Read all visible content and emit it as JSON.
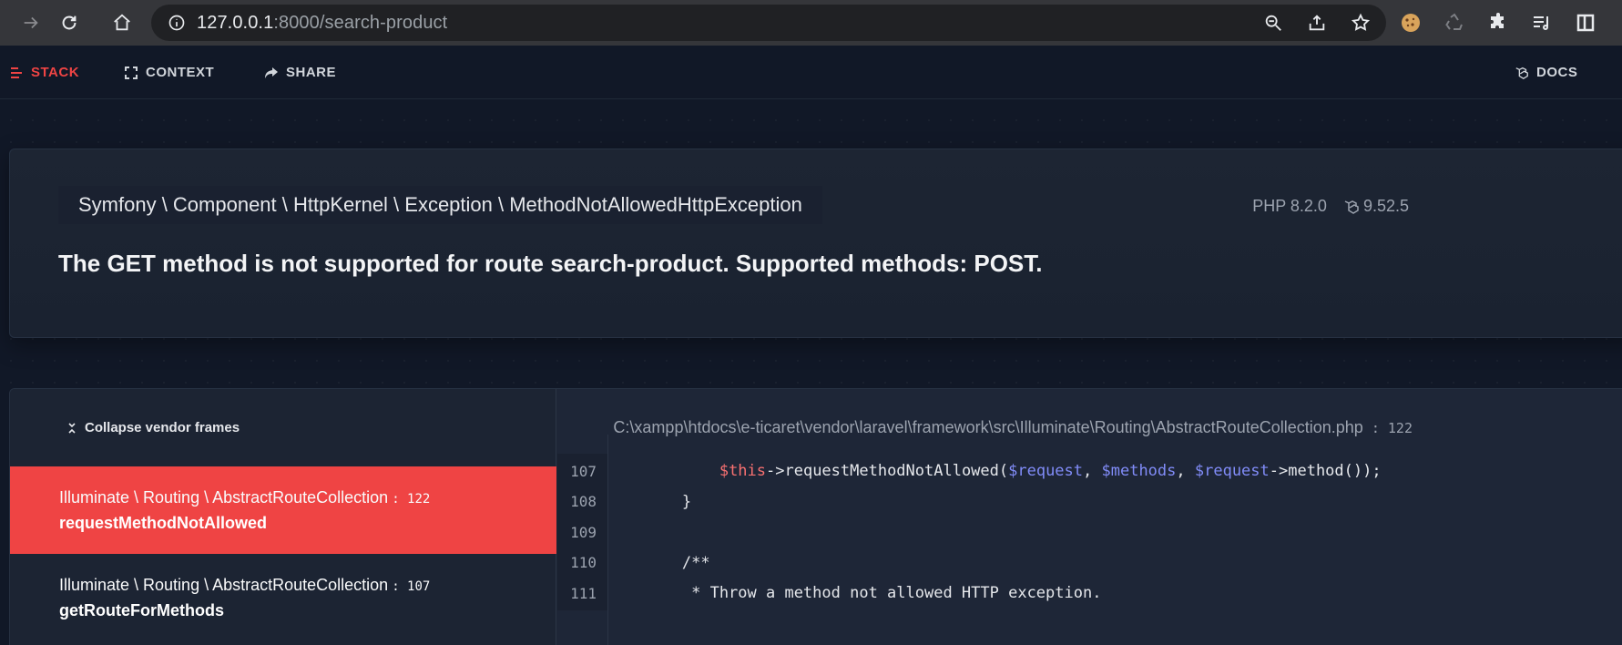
{
  "browser": {
    "url_host": "127.0.0.1",
    "url_path": ":8000/search-product"
  },
  "nav": {
    "stack": "STACK",
    "context": "CONTEXT",
    "share": "SHARE",
    "docs": "DOCS"
  },
  "exception": {
    "class": "Symfony \\ Component \\ HttpKernel \\ Exception \\ MethodNotAllowedHttpException",
    "php_version": "PHP 8.2.0",
    "laravel_version": "9.52.5",
    "message": "The GET method is not supported for route search-product. Supported methods: POST."
  },
  "stack": {
    "collapse_label": "Collapse vendor frames",
    "frames": [
      {
        "class": "Illuminate \\ Routing \\ AbstractRouteCollection",
        "line": ": 122",
        "method": "requestMethodNotAllowed",
        "active": true
      },
      {
        "class": "Illuminate \\ Routing \\ AbstractRouteCollection",
        "line": ": 107",
        "method": "getRouteForMethods",
        "active": false
      }
    ]
  },
  "code": {
    "file_path": "C:\\xampp\\htdocs\\e-ticaret\\vendor\\laravel\\framework\\src\\Illuminate\\Routing\\AbstractRouteCollection",
    "file_ext": ".php",
    "file_line": " : 122",
    "lines": [
      {
        "num": "107",
        "parts": [
          {
            "t": "            ",
            "c": ""
          },
          {
            "t": "$this",
            "c": "this"
          },
          {
            "t": "->requestMethodNotAllowed(",
            "c": ""
          },
          {
            "t": "$request",
            "c": "var"
          },
          {
            "t": ", ",
            "c": ""
          },
          {
            "t": "$methods",
            "c": "var"
          },
          {
            "t": ", ",
            "c": ""
          },
          {
            "t": "$request",
            "c": "var"
          },
          {
            "t": "->method());",
            "c": ""
          }
        ]
      },
      {
        "num": "108",
        "parts": [
          {
            "t": "        }",
            "c": ""
          }
        ]
      },
      {
        "num": "109",
        "parts": [
          {
            "t": "",
            "c": ""
          }
        ]
      },
      {
        "num": "110",
        "parts": [
          {
            "t": "        /**",
            "c": ""
          }
        ]
      },
      {
        "num": "111",
        "parts": [
          {
            "t": "         * Throw a method not allowed HTTP exception.",
            "c": ""
          }
        ]
      }
    ]
  }
}
